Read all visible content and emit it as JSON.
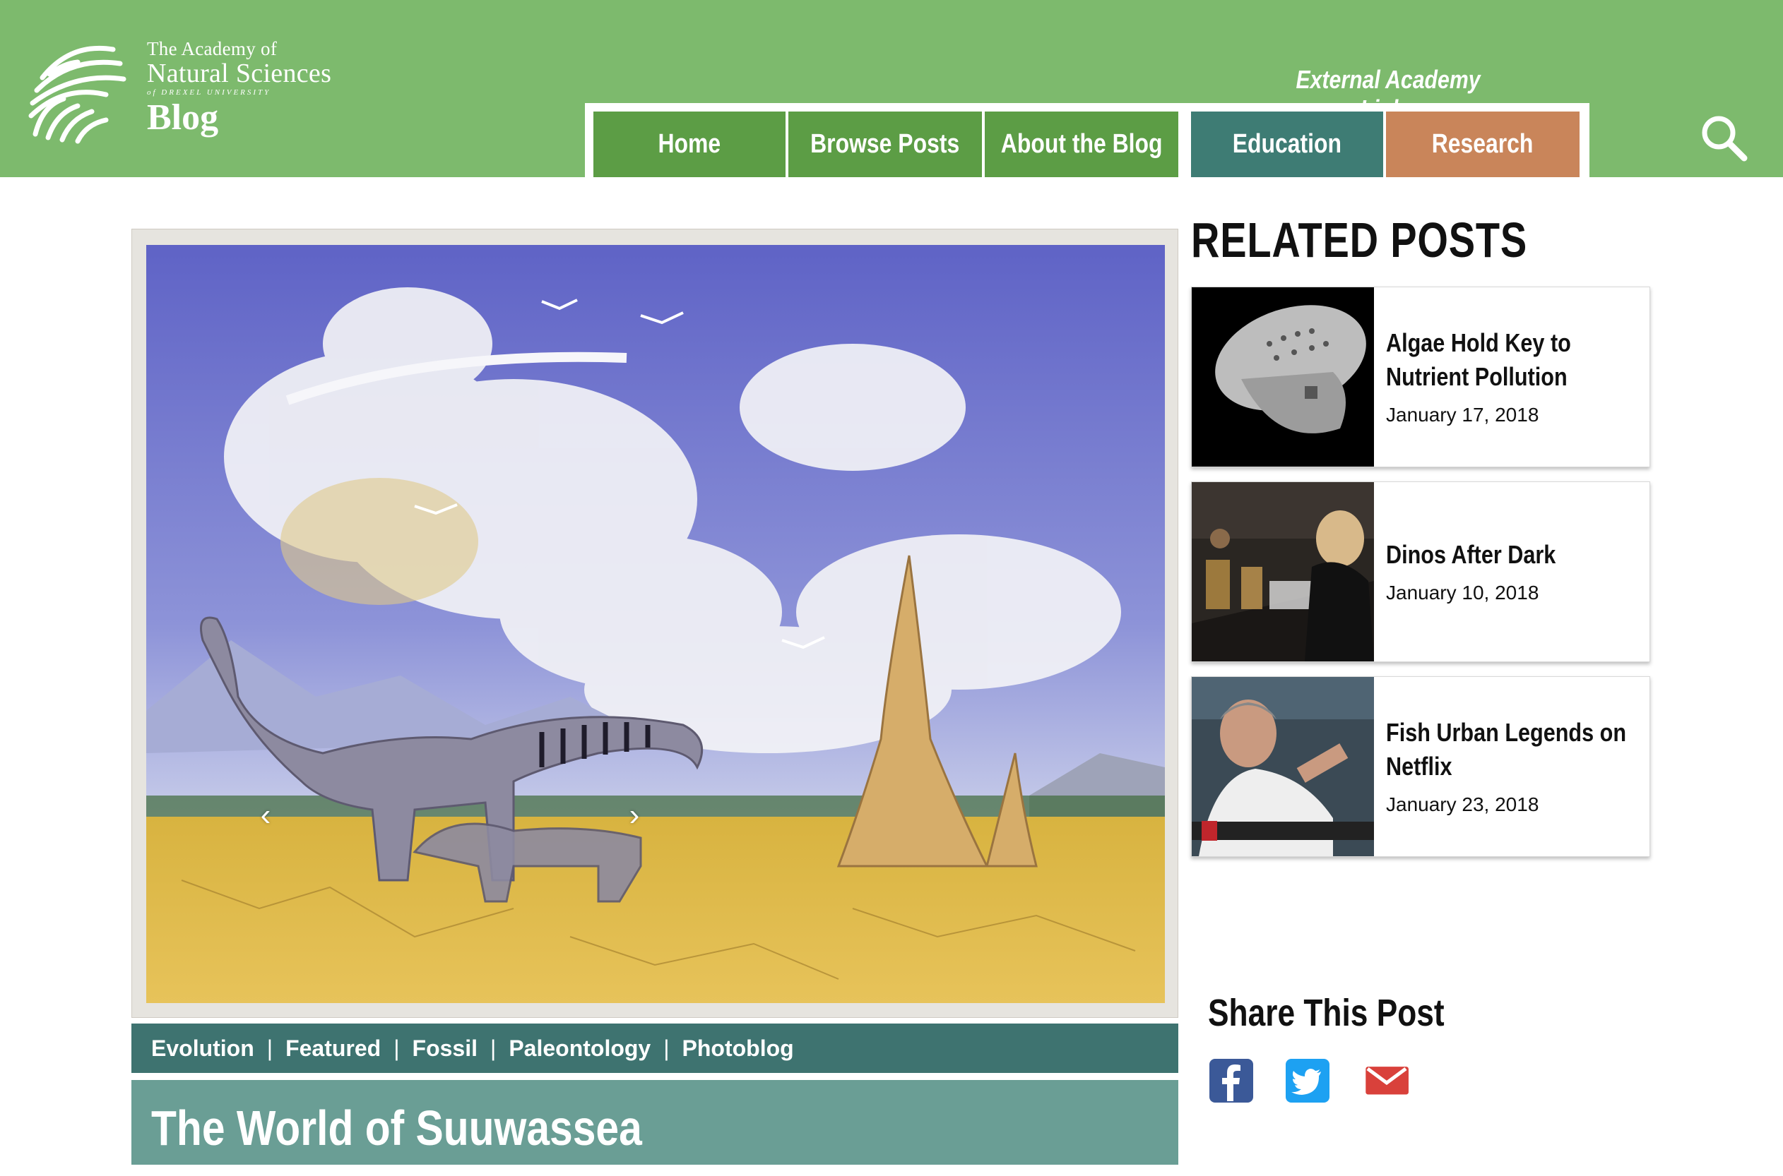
{
  "header": {
    "logo": {
      "line1": "The Academy of",
      "line2": "Natural Sciences",
      "line3": "of DREXEL UNIVERSITY",
      "line4": "Blog"
    },
    "external_links_label": "External Academy Links",
    "nav": [
      {
        "label": "Home"
      },
      {
        "label": "Browse Posts"
      },
      {
        "label": "About the Blog"
      },
      {
        "label": "Education"
      },
      {
        "label": "Research"
      }
    ],
    "search_icon": "search-icon"
  },
  "post": {
    "carousel": {
      "prev": "‹",
      "next": "›"
    },
    "tags": [
      "Evolution",
      "Featured",
      "Fossil",
      "Paleontology",
      "Photoblog"
    ],
    "tag_separator": "|",
    "title": "The World of Suuwassea"
  },
  "related": {
    "heading": "RELATED POSTS",
    "posts": [
      {
        "title": "Algae Hold Key to Nutrient Pollution",
        "date": "January 17, 2018",
        "thumb": "diatom-micrograph"
      },
      {
        "title": "Dinos After Dark",
        "date": "January 10, 2018",
        "thumb": "museum-event-photo"
      },
      {
        "title": "Fish Urban Legends on Netflix",
        "date": "January 23, 2018",
        "thumb": "scientist-video-still"
      }
    ]
  },
  "share": {
    "heading": "Share This Post",
    "icons": [
      "facebook-icon",
      "twitter-icon",
      "email-icon"
    ]
  },
  "colors": {
    "header_green": "#7dba6d",
    "nav_green": "#5c9d45",
    "nav_teal": "#3e7c74",
    "nav_orange": "#c9855a",
    "tag_bar": "#3e7370",
    "title_bar": "#6a9e95",
    "facebook": "#3b5998",
    "twitter": "#1da1f2",
    "email": "#d9413b"
  }
}
